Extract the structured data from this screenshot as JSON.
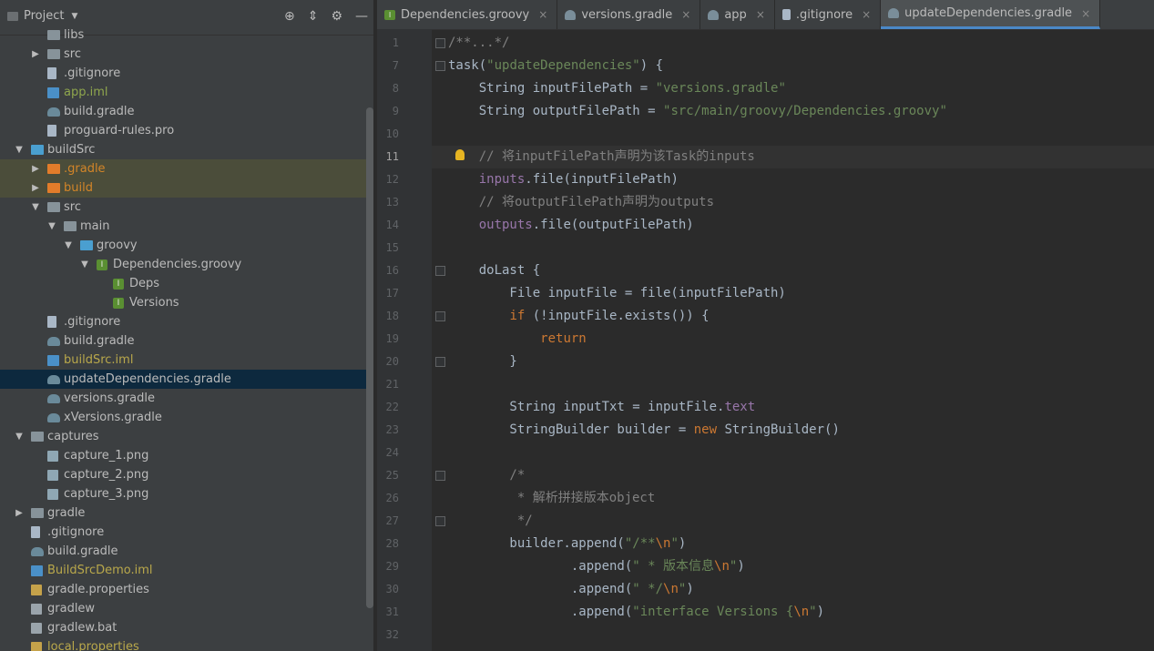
{
  "project_panel": {
    "title": "Project",
    "tools": [
      "target-icon",
      "collapse-icon",
      "gear-icon",
      "minimize-icon"
    ]
  },
  "tree": [
    {
      "label": "libs",
      "icon": "folder",
      "indent": 1,
      "arrow": "",
      "color": "normal"
    },
    {
      "label": "src",
      "icon": "folder",
      "indent": 1,
      "arrow": "▶",
      "color": "normal"
    },
    {
      "label": ".gitignore",
      "icon": "file",
      "indent": 1,
      "arrow": "",
      "color": "normal"
    },
    {
      "label": "app.iml",
      "icon": "iml",
      "indent": 1,
      "arrow": "",
      "color": "green"
    },
    {
      "label": "build.gradle",
      "icon": "gradle",
      "indent": 1,
      "arrow": "",
      "color": "normal"
    },
    {
      "label": "proguard-rules.pro",
      "icon": "file",
      "indent": 1,
      "arrow": "",
      "color": "normal"
    },
    {
      "label": "buildSrc",
      "icon": "folder-blue",
      "indent": 0,
      "arrow": "▼",
      "color": "normal"
    },
    {
      "label": ".gradle",
      "icon": "folder-orange",
      "indent": 1,
      "arrow": "▶",
      "color": "orange",
      "hl": true
    },
    {
      "label": "build",
      "icon": "folder-orange",
      "indent": 1,
      "arrow": "▶",
      "color": "orange",
      "hl": true
    },
    {
      "label": "src",
      "icon": "folder",
      "indent": 1,
      "arrow": "▼",
      "color": "normal"
    },
    {
      "label": "main",
      "icon": "folder",
      "indent": 2,
      "arrow": "▼",
      "color": "normal"
    },
    {
      "label": "groovy",
      "icon": "folder-blue",
      "indent": 3,
      "arrow": "▼",
      "color": "normal"
    },
    {
      "label": "Dependencies.groovy",
      "icon": "groovy",
      "indent": 4,
      "arrow": "▼",
      "color": "normal"
    },
    {
      "label": "Deps",
      "icon": "groovy",
      "indent": 5,
      "arrow": "",
      "color": "normal"
    },
    {
      "label": "Versions",
      "icon": "groovy",
      "indent": 5,
      "arrow": "",
      "color": "normal"
    },
    {
      "label": ".gitignore",
      "icon": "file",
      "indent": 1,
      "arrow": "",
      "color": "normal"
    },
    {
      "label": "build.gradle",
      "icon": "gradle",
      "indent": 1,
      "arrow": "",
      "color": "normal"
    },
    {
      "label": "buildSrc.iml",
      "icon": "iml",
      "indent": 1,
      "arrow": "",
      "color": "yellow"
    },
    {
      "label": "updateDependencies.gradle",
      "icon": "gradle",
      "indent": 1,
      "arrow": "",
      "color": "normal",
      "sel": true
    },
    {
      "label": "versions.gradle",
      "icon": "gradle",
      "indent": 1,
      "arrow": "",
      "color": "normal"
    },
    {
      "label": "xVersions.gradle",
      "icon": "gradle",
      "indent": 1,
      "arrow": "",
      "color": "normal"
    },
    {
      "label": "captures",
      "icon": "folder",
      "indent": 0,
      "arrow": "▼",
      "color": "normal"
    },
    {
      "label": "capture_1.png",
      "icon": "image",
      "indent": 1,
      "arrow": "",
      "color": "normal"
    },
    {
      "label": "capture_2.png",
      "icon": "image",
      "indent": 1,
      "arrow": "",
      "color": "normal"
    },
    {
      "label": "capture_3.png",
      "icon": "image",
      "indent": 1,
      "arrow": "",
      "color": "normal"
    },
    {
      "label": "gradle",
      "icon": "folder",
      "indent": 0,
      "arrow": "▶",
      "color": "normal"
    },
    {
      "label": ".gitignore",
      "icon": "file",
      "indent": 0,
      "arrow": "",
      "color": "normal"
    },
    {
      "label": "build.gradle",
      "icon": "gradle",
      "indent": 0,
      "arrow": "",
      "color": "normal"
    },
    {
      "label": "BuildSrcDemo.iml",
      "icon": "iml",
      "indent": 0,
      "arrow": "",
      "color": "yellow"
    },
    {
      "label": "gradle.properties",
      "icon": "props",
      "indent": 0,
      "arrow": "",
      "color": "normal"
    },
    {
      "label": "gradlew",
      "icon": "term",
      "indent": 0,
      "arrow": "",
      "color": "normal"
    },
    {
      "label": "gradlew.bat",
      "icon": "term",
      "indent": 0,
      "arrow": "",
      "color": "normal"
    },
    {
      "label": "local.properties",
      "icon": "props",
      "indent": 0,
      "arrow": "",
      "color": "yellow"
    }
  ],
  "tabs": [
    {
      "label": "Dependencies.groovy",
      "icon": "groovy",
      "active": false
    },
    {
      "label": "versions.gradle",
      "icon": "gradle",
      "active": false
    },
    {
      "label": "app",
      "icon": "gradle",
      "active": false
    },
    {
      "label": ".gitignore",
      "icon": "file",
      "active": false
    },
    {
      "label": "updateDependencies.gradle",
      "icon": "gradle",
      "active": true
    }
  ],
  "current_line": 11,
  "code_lines": [
    {
      "n": 1,
      "fold": "plus",
      "tokens": [
        [
          "/**...*/",
          "cm"
        ]
      ]
    },
    {
      "n": 7,
      "fold": "minus",
      "tokens": [
        [
          "task(",
          "pl"
        ],
        [
          "\"updateDependencies\"",
          "str"
        ],
        [
          ") {",
          "pl"
        ]
      ]
    },
    {
      "n": 8,
      "tokens": [
        [
          "    String inputFilePath = ",
          "pl"
        ],
        [
          "\"versions.gradle\"",
          "str"
        ]
      ]
    },
    {
      "n": 9,
      "tokens": [
        [
          "    String outputFilePath = ",
          "pl"
        ],
        [
          "\"src/main/groovy/Dependencies.groovy\"",
          "str"
        ]
      ]
    },
    {
      "n": 10,
      "tokens": []
    },
    {
      "n": 11,
      "bulb": true,
      "tokens": [
        [
          "    // 将inputFilePath声明为该Task的inputs",
          "cm"
        ]
      ]
    },
    {
      "n": 12,
      "tokens": [
        [
          "    ",
          "pl"
        ],
        [
          "inputs",
          "fn"
        ],
        [
          ".file(inputFilePath)",
          "pl"
        ]
      ]
    },
    {
      "n": 13,
      "tokens": [
        [
          "    // 将outputFilePath声明为outputs",
          "cm"
        ]
      ]
    },
    {
      "n": 14,
      "tokens": [
        [
          "    ",
          "pl"
        ],
        [
          "outputs",
          "fn"
        ],
        [
          ".file(outputFilePath)",
          "pl"
        ]
      ]
    },
    {
      "n": 15,
      "tokens": []
    },
    {
      "n": 16,
      "fold": "minus",
      "tokens": [
        [
          "    doLast {",
          "pl"
        ]
      ]
    },
    {
      "n": 17,
      "tokens": [
        [
          "        File inputFile = file(inputFilePath)",
          "pl"
        ]
      ]
    },
    {
      "n": 18,
      "fold": "minus",
      "tokens": [
        [
          "        ",
          "pl"
        ],
        [
          "if",
          "kw"
        ],
        [
          " (!inputFile.exists()) {",
          "pl"
        ]
      ]
    },
    {
      "n": 19,
      "tokens": [
        [
          "            ",
          "pl"
        ],
        [
          "return",
          "kw"
        ]
      ]
    },
    {
      "n": 20,
      "fold": "minus",
      "tokens": [
        [
          "        }",
          "pl"
        ]
      ]
    },
    {
      "n": 21,
      "tokens": []
    },
    {
      "n": 22,
      "tokens": [
        [
          "        String inputTxt = inputFile.",
          "pl"
        ],
        [
          "text",
          "fn"
        ]
      ]
    },
    {
      "n": 23,
      "tokens": [
        [
          "        StringBuilder builder = ",
          "pl"
        ],
        [
          "new",
          "kw"
        ],
        [
          " StringBuilder()",
          "pl"
        ]
      ]
    },
    {
      "n": 24,
      "tokens": []
    },
    {
      "n": 25,
      "fold": "minus",
      "tokens": [
        [
          "        /*",
          "cm"
        ]
      ]
    },
    {
      "n": 26,
      "tokens": [
        [
          "         * 解析拼接版本object",
          "cm"
        ]
      ]
    },
    {
      "n": 27,
      "fold": "minus",
      "tokens": [
        [
          "         */",
          "cm"
        ]
      ]
    },
    {
      "n": 28,
      "tokens": [
        [
          "        builder.append(",
          "pl"
        ],
        [
          "\"/**",
          "str"
        ],
        [
          "\\n",
          "kw"
        ],
        [
          "\"",
          "str"
        ],
        [
          ")",
          "pl"
        ]
      ]
    },
    {
      "n": 29,
      "tokens": [
        [
          "                .append(",
          "pl"
        ],
        [
          "\" * 版本信息",
          "str"
        ],
        [
          "\\n",
          "kw"
        ],
        [
          "\"",
          "str"
        ],
        [
          ")",
          "pl"
        ]
      ]
    },
    {
      "n": 30,
      "tokens": [
        [
          "                .append(",
          "pl"
        ],
        [
          "\" */",
          "str"
        ],
        [
          "\\n",
          "kw"
        ],
        [
          "\"",
          "str"
        ],
        [
          ")",
          "pl"
        ]
      ]
    },
    {
      "n": 31,
      "tokens": [
        [
          "                .append(",
          "pl"
        ],
        [
          "\"interface Versions {",
          "str"
        ],
        [
          "\\n",
          "kw"
        ],
        [
          "\"",
          "str"
        ],
        [
          ")",
          "pl"
        ]
      ]
    },
    {
      "n": 32,
      "tokens": []
    }
  ]
}
